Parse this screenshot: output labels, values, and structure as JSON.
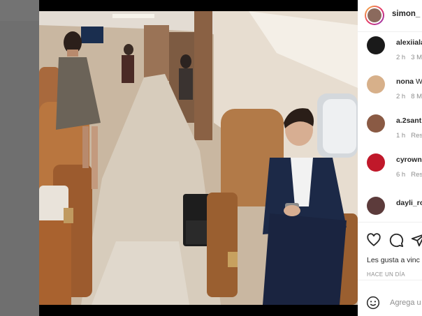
{
  "post": {
    "username": "simon_",
    "comments": [
      {
        "user": "alexiiala",
        "text": "",
        "time": "2 h",
        "likes": "3 M",
        "color": "#1a1a1a"
      },
      {
        "user": "nona",
        "text": "W",
        "time": "2 h",
        "likes": "8 M",
        "color": "#d7b08a"
      },
      {
        "user": "a.2sant",
        "text": "",
        "time": "1 h",
        "likes": "Res",
        "color": "#8a5a44"
      },
      {
        "user": "cyrown",
        "text": "",
        "time": "6 h",
        "likes": "Res",
        "color": "#c0182a"
      },
      {
        "user": "dayli_ro",
        "text": "",
        "time": "",
        "likes": "",
        "color": "#5c3b3b"
      }
    ],
    "likes_text": "Les gusta a vinc",
    "date_text": "HACE UN DÍA",
    "add_comment_placeholder": "Agrega u"
  },
  "icons": [
    "heart-icon",
    "comment-icon",
    "share-icon",
    "emoji-icon"
  ]
}
